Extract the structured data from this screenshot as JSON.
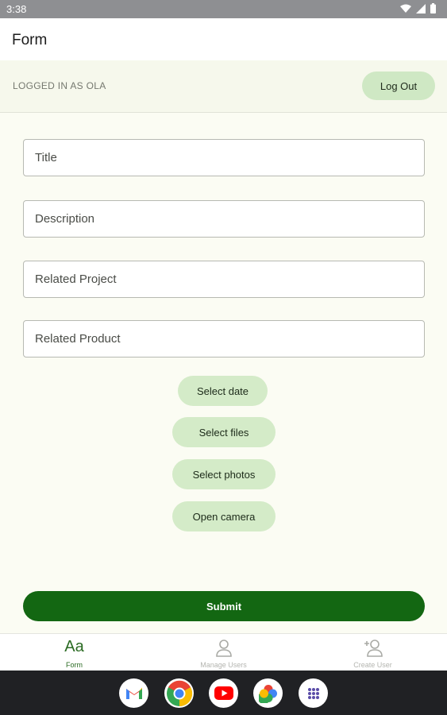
{
  "status_bar": {
    "time": "3:38"
  },
  "app_bar": {
    "title": "Form"
  },
  "user_bar": {
    "logged_in_text": "LOGGED IN AS OLA",
    "logout_label": "Log Out"
  },
  "form": {
    "title_placeholder": "Title",
    "description_placeholder": "Description",
    "related_project_placeholder": "Related Project",
    "related_product_placeholder": "Related Product",
    "select_date_label": "Select date",
    "select_files_label": "Select files",
    "select_photos_label": "Select photos",
    "open_camera_label": "Open camera",
    "submit_label": "Submit"
  },
  "bottom_nav": {
    "items": [
      {
        "label": "Form",
        "icon": "text-format-icon",
        "active": true
      },
      {
        "label": "Manage Users",
        "icon": "person-icon",
        "active": false
      },
      {
        "label": "Create User",
        "icon": "person-add-icon",
        "active": false
      }
    ]
  },
  "dock": {
    "apps": [
      {
        "name": "Gmail",
        "icon": "gmail-icon"
      },
      {
        "name": "Chrome",
        "icon": "chrome-icon"
      },
      {
        "name": "YouTube",
        "icon": "youtube-icon"
      },
      {
        "name": "Photos",
        "icon": "photos-icon"
      },
      {
        "name": "App drawer",
        "icon": "app-drawer-icon"
      }
    ]
  },
  "colors": {
    "primary": "#136712",
    "primary_container": "#d4ebc8",
    "surface": "#fbfcf3",
    "status_bar": "#8e8f92"
  }
}
